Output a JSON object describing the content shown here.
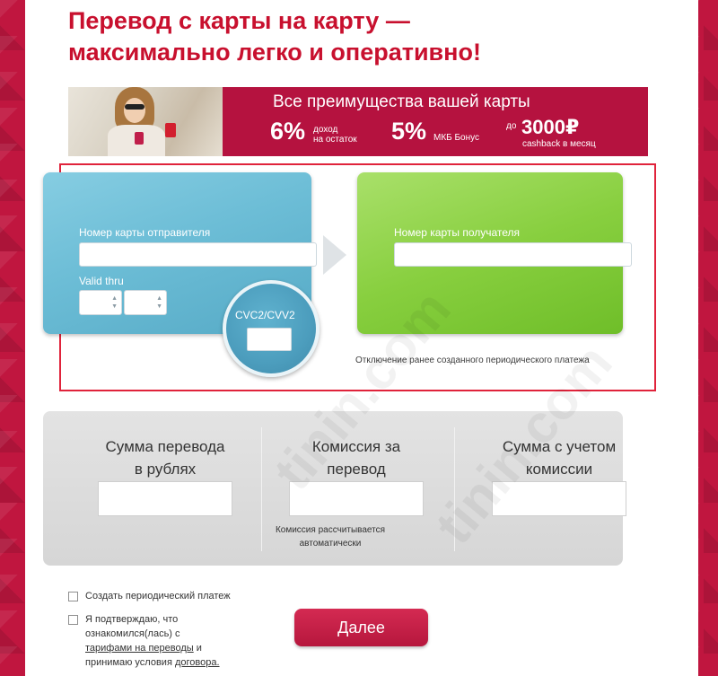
{
  "headline": {
    "line1": "Перевод с карты на карту —",
    "line2": "максимально легко и оперативно!"
  },
  "banner": {
    "title": "Все преимущества вашей карты",
    "promo1_big": "6%",
    "promo1_small_1": "доход",
    "promo1_small_2": "на остаток",
    "promo2_big": "5%",
    "promo2_small": "МКБ Бонус",
    "promo3_prefix": "до",
    "promo3_big": "3000₽",
    "promo3_small": "cashback в месяц"
  },
  "sender_card": {
    "number_label": "Номер карты отправителя",
    "valid_thru_label": "Valid thru",
    "cvc_label": "CVC2/CVV2",
    "spinner_up": "▲",
    "spinner_down": "▼"
  },
  "receiver_card": {
    "number_label": "Номер карты получателя",
    "cancel_link": "Отключение ранее созданного периодического платежа"
  },
  "calc": {
    "amount_line1": "Сумма перевода",
    "amount_line2": "в рублях",
    "fee_line1": "Комиссия за",
    "fee_line2": "перевод",
    "total_line1": "Сумма с учетом",
    "total_line2": "комиссии",
    "fee_note_line1": "Комиссия рассчитывается",
    "fee_note_line2": "автоматически"
  },
  "options": {
    "periodic_label": "Создать периодический платеж",
    "agree_line1": "Я подтверждаю, что",
    "agree_line2": "ознакомился(лась) с",
    "agree_link1": "тарифами на переводы",
    "agree_and": "и",
    "agree_line4": "принимаю условия",
    "agree_link2": "договора."
  },
  "next_button": "Далее",
  "watermark": "tinin.com",
  "colors": {
    "brand": "#c8102e",
    "sender_card": "#6cbdd6",
    "receiver_card": "#88cf3f",
    "button": "#c21f48"
  }
}
